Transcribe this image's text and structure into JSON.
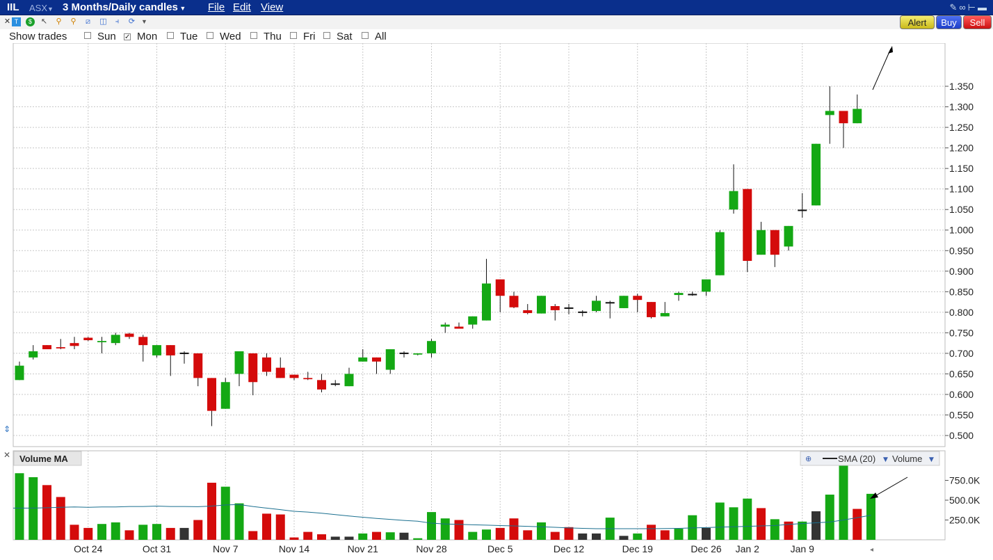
{
  "title_bar": {
    "symbol": "IIL",
    "exchange": "ASX",
    "period": "3 Months/Daily candles",
    "menus": [
      "File",
      "Edit",
      "View"
    ]
  },
  "action_buttons": {
    "alert": "Alert",
    "buy": "Buy",
    "sell": "Sell"
  },
  "trades_bar": {
    "label": "Show trades",
    "days": [
      {
        "label": "Sun",
        "checked": false
      },
      {
        "label": "Mon",
        "checked": true
      },
      {
        "label": "Tue",
        "checked": false
      },
      {
        "label": "Wed",
        "checked": false
      },
      {
        "label": "Thu",
        "checked": false
      },
      {
        "label": "Fri",
        "checked": false
      },
      {
        "label": "Sat",
        "checked": false
      },
      {
        "label": "All",
        "checked": false
      }
    ]
  },
  "chart_data": [
    {
      "type": "candlestick",
      "x_ticks": [
        "Oct 24",
        "Oct 31",
        "Nov 7",
        "Nov 14",
        "Nov 21",
        "Nov 28",
        "Dec 5",
        "Dec 12",
        "Dec 19",
        "Dec 26",
        "Jan 2",
        "Jan 9"
      ],
      "y_ticks": [
        "0.500",
        "0.550",
        "0.600",
        "0.650",
        "0.700",
        "0.750",
        "0.800",
        "0.850",
        "0.900",
        "0.950",
        "1.000",
        "1.050",
        "1.100",
        "1.150",
        "1.200",
        "1.250",
        "1.300",
        "1.350"
      ],
      "ylim": [
        0.473,
        1.455
      ],
      "grid": true,
      "up_color": "#14a814",
      "down_color": "#d40b0b",
      "candles": [
        {
          "o": 0.635,
          "h": 0.68,
          "l": 0.635,
          "c": 0.67
        },
        {
          "o": 0.69,
          "h": 0.72,
          "l": 0.685,
          "c": 0.705
        },
        {
          "o": 0.72,
          "h": 0.72,
          "l": 0.71,
          "c": 0.71
        },
        {
          "o": 0.715,
          "h": 0.735,
          "l": 0.71,
          "c": 0.712
        },
        {
          "o": 0.725,
          "h": 0.74,
          "l": 0.71,
          "c": 0.718
        },
        {
          "o": 0.738,
          "h": 0.74,
          "l": 0.73,
          "c": 0.732
        },
        {
          "o": 0.727,
          "h": 0.74,
          "l": 0.7,
          "c": 0.73
        },
        {
          "o": 0.725,
          "h": 0.75,
          "l": 0.72,
          "c": 0.745
        },
        {
          "o": 0.748,
          "h": 0.75,
          "l": 0.735,
          "c": 0.74
        },
        {
          "o": 0.74,
          "h": 0.745,
          "l": 0.68,
          "c": 0.72
        },
        {
          "o": 0.695,
          "h": 0.72,
          "l": 0.69,
          "c": 0.72
        },
        {
          "o": 0.72,
          "h": 0.72,
          "l": 0.645,
          "c": 0.695
        },
        {
          "o": 0.7,
          "h": 0.705,
          "l": 0.675,
          "c": 0.7
        },
        {
          "o": 0.7,
          "h": 0.7,
          "l": 0.62,
          "c": 0.64
        },
        {
          "o": 0.64,
          "h": 0.64,
          "l": 0.523,
          "c": 0.56
        },
        {
          "o": 0.565,
          "h": 0.64,
          "l": 0.565,
          "c": 0.63
        },
        {
          "o": 0.65,
          "h": 0.705,
          "l": 0.62,
          "c": 0.705
        },
        {
          "o": 0.7,
          "h": 0.7,
          "l": 0.598,
          "c": 0.63
        },
        {
          "o": 0.69,
          "h": 0.7,
          "l": 0.645,
          "c": 0.655
        },
        {
          "o": 0.665,
          "h": 0.69,
          "l": 0.64,
          "c": 0.64
        },
        {
          "o": 0.648,
          "h": 0.648,
          "l": 0.635,
          "c": 0.64
        },
        {
          "o": 0.64,
          "h": 0.655,
          "l": 0.635,
          "c": 0.637
        },
        {
          "o": 0.635,
          "h": 0.65,
          "l": 0.605,
          "c": 0.612
        },
        {
          "o": 0.625,
          "h": 0.635,
          "l": 0.62,
          "c": 0.625
        },
        {
          "o": 0.62,
          "h": 0.665,
          "l": 0.62,
          "c": 0.65
        },
        {
          "o": 0.68,
          "h": 0.71,
          "l": 0.68,
          "c": 0.69
        },
        {
          "o": 0.69,
          "h": 0.69,
          "l": 0.65,
          "c": 0.68
        },
        {
          "o": 0.66,
          "h": 0.71,
          "l": 0.65,
          "c": 0.71
        },
        {
          "o": 0.7,
          "h": 0.705,
          "l": 0.69,
          "c": 0.7
        },
        {
          "o": 0.697,
          "h": 0.7,
          "l": 0.695,
          "c": 0.7
        },
        {
          "o": 0.7,
          "h": 0.735,
          "l": 0.69,
          "c": 0.73
        },
        {
          "o": 0.765,
          "h": 0.775,
          "l": 0.75,
          "c": 0.77
        },
        {
          "o": 0.765,
          "h": 0.775,
          "l": 0.76,
          "c": 0.76
        },
        {
          "o": 0.77,
          "h": 0.79,
          "l": 0.76,
          "c": 0.79
        },
        {
          "o": 0.78,
          "h": 0.93,
          "l": 0.78,
          "c": 0.87
        },
        {
          "o": 0.88,
          "h": 0.88,
          "l": 0.8,
          "c": 0.84
        },
        {
          "o": 0.84,
          "h": 0.85,
          "l": 0.81,
          "c": 0.812
        },
        {
          "o": 0.805,
          "h": 0.82,
          "l": 0.795,
          "c": 0.798
        },
        {
          "o": 0.797,
          "h": 0.84,
          "l": 0.797,
          "c": 0.84
        },
        {
          "o": 0.815,
          "h": 0.82,
          "l": 0.78,
          "c": 0.805
        },
        {
          "o": 0.81,
          "h": 0.82,
          "l": 0.795,
          "c": 0.81
        },
        {
          "o": 0.8,
          "h": 0.805,
          "l": 0.79,
          "c": 0.8
        },
        {
          "o": 0.803,
          "h": 0.84,
          "l": 0.8,
          "c": 0.828
        },
        {
          "o": 0.823,
          "h": 0.828,
          "l": 0.785,
          "c": 0.823
        },
        {
          "o": 0.81,
          "h": 0.84,
          "l": 0.81,
          "c": 0.84
        },
        {
          "o": 0.84,
          "h": 0.845,
          "l": 0.8,
          "c": 0.83
        },
        {
          "o": 0.825,
          "h": 0.825,
          "l": 0.785,
          "c": 0.788
        },
        {
          "o": 0.79,
          "h": 0.825,
          "l": 0.79,
          "c": 0.798
        },
        {
          "o": 0.842,
          "h": 0.85,
          "l": 0.828,
          "c": 0.847
        },
        {
          "o": 0.843,
          "h": 0.85,
          "l": 0.84,
          "c": 0.843
        },
        {
          "o": 0.85,
          "h": 0.88,
          "l": 0.84,
          "c": 0.88
        },
        {
          "o": 0.89,
          "h": 1.0,
          "l": 0.89,
          "c": 0.995
        },
        {
          "o": 1.05,
          "h": 1.16,
          "l": 1.04,
          "c": 1.095
        },
        {
          "o": 1.1,
          "h": 1.1,
          "l": 0.898,
          "c": 0.925
        },
        {
          "o": 0.94,
          "h": 1.02,
          "l": 0.94,
          "c": 1.0
        },
        {
          "o": 1.0,
          "h": 1.0,
          "l": 0.91,
          "c": 0.94
        },
        {
          "o": 0.96,
          "h": 1.01,
          "l": 0.95,
          "c": 1.01
        },
        {
          "o": 1.048,
          "h": 1.09,
          "l": 1.03,
          "c": 1.048
        },
        {
          "o": 1.06,
          "h": 1.21,
          "l": 1.06,
          "c": 1.21
        },
        {
          "o": 1.28,
          "h": 1.35,
          "l": 1.21,
          "c": 1.29
        },
        {
          "o": 1.29,
          "h": 1.29,
          "l": 1.2,
          "c": 1.26
        },
        {
          "o": 1.26,
          "h": 1.33,
          "l": 1.26,
          "c": 1.295
        }
      ]
    },
    {
      "type": "bar",
      "title": "Volume MA",
      "legend": [
        "SMA (20)",
        "Volume"
      ],
      "y_ticks": [
        "250.0K",
        "500.0K",
        "750.0K"
      ],
      "ylim": [
        0,
        1000000
      ],
      "neutral_color": "#333333",
      "volumes": [
        840000,
        790000,
        690000,
        540000,
        190000,
        150000,
        200000,
        220000,
        120000,
        190000,
        200000,
        150000,
        150000,
        250000,
        720000,
        670000,
        460000,
        110000,
        330000,
        320000,
        30000,
        100000,
        70000,
        40000,
        40000,
        80000,
        100000,
        95000,
        90000,
        20000,
        350000,
        270000,
        250000,
        100000,
        130000,
        150000,
        270000,
        120000,
        220000,
        100000,
        160000,
        80000,
        80000,
        280000,
        50000,
        80000,
        190000,
        120000,
        140000,
        310000,
        150000,
        470000,
        410000,
        520000,
        400000,
        260000,
        230000,
        230000,
        360000,
        570000,
        990000,
        390000,
        580000
      ],
      "vol_colors": [
        "u",
        "u",
        "d",
        "d",
        "d",
        "d",
        "u",
        "u",
        "d",
        "u",
        "u",
        "d",
        "n",
        "d",
        "d",
        "u",
        "u",
        "d",
        "d",
        "d",
        "d",
        "d",
        "d",
        "n",
        "n",
        "u",
        "d",
        "u",
        "n",
        "u",
        "u",
        "u",
        "d",
        "u",
        "u",
        "d",
        "d",
        "d",
        "u",
        "d",
        "d",
        "n",
        "n",
        "u",
        "n",
        "u",
        "d",
        "d",
        "u",
        "u",
        "n",
        "u",
        "u",
        "u",
        "d",
        "u",
        "d",
        "u",
        "n",
        "u",
        "u",
        "d",
        "u"
      ],
      "sma": [
        400000,
        400000,
        405000,
        410000,
        415000,
        410000,
        415000,
        415000,
        420000,
        420000,
        425000,
        420000,
        420000,
        418000,
        425000,
        440000,
        445000,
        420000,
        400000,
        380000,
        360000,
        350000,
        335000,
        318000,
        300000,
        285000,
        270000,
        258000,
        245000,
        235000,
        210000,
        200000,
        195000,
        190000,
        185000,
        180000,
        175000,
        170000,
        165000,
        158000,
        150000,
        145000,
        140000,
        140000,
        140000,
        140000,
        140000,
        142000,
        145000,
        150000,
        155000,
        160000,
        165000,
        170000,
        175000,
        180000,
        195000,
        205000,
        215000,
        225000,
        250000,
        280000,
        310000
      ]
    }
  ]
}
